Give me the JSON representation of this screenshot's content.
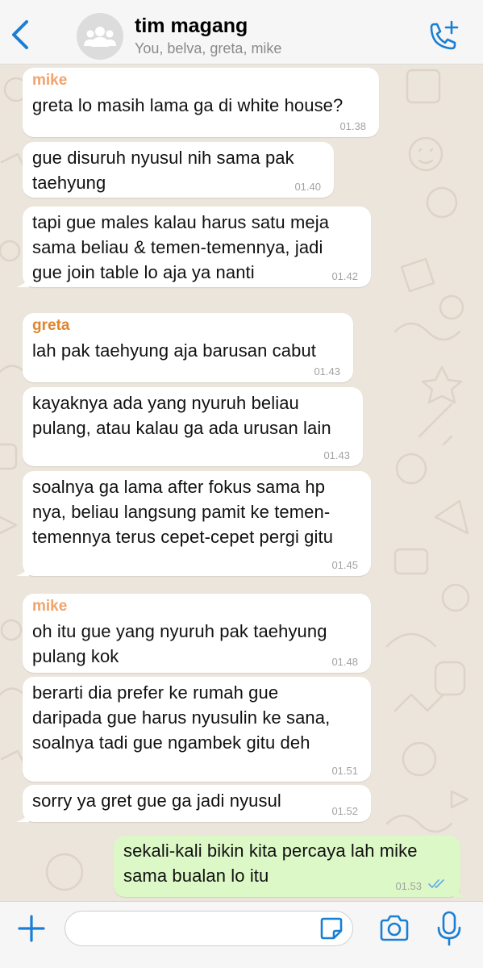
{
  "header": {
    "title": "tim magang",
    "subtitle": "You, belva, greta, mike",
    "back_icon": "chevron-left-icon",
    "avatar_icon": "group-icon",
    "call_icon": "add-call-icon",
    "accent": "#1a7fd4"
  },
  "messages": [
    {
      "sender": "mike",
      "sender_color": "#f0a36b",
      "text": "greta lo masih lama ga di white house?",
      "time": "01.38"
    },
    {
      "text": "gue disuruh nyusul nih sama pak\ntaehyung",
      "time": "01.40"
    },
    {
      "text": "tapi gue males kalau harus satu meja\nsama beliau & temen-temennya, jadi\ngue join table lo aja ya nanti",
      "time": "01.42"
    },
    {
      "sender": "greta",
      "sender_color": "#e0852c",
      "text": "lah pak taehyung aja barusan cabut",
      "time": "01.43"
    },
    {
      "text": "kayaknya ada yang nyuruh beliau\npulang, atau kalau ga ada urusan lain",
      "time": "01.43"
    },
    {
      "text": "soalnya ga lama after fokus sama hp\nnya, beliau langsung pamit ke temen-\ntemennya terus cepet-cepet pergi gitu",
      "time": "01.45"
    },
    {
      "sender": "mike",
      "sender_color": "#f0a36b",
      "text": "oh itu gue yang nyuruh pak taehyung\npulang kok",
      "time": "01.48"
    },
    {
      "text": "berarti dia prefer ke rumah gue\ndaripada gue harus nyusulin ke sana,\nsoalnya tadi gue ngambek gitu deh",
      "time": "01.51"
    },
    {
      "text": "sorry ya gret gue ga jadi nyusul",
      "time": "01.52"
    },
    {
      "text": "sekali-kali bikin kita percaya lah mike\nsama bualan lo itu",
      "time": "01.53",
      "outgoing": true,
      "status_icon": "double-check-icon"
    }
  ],
  "input_bar": {
    "plus_icon": "plus-icon",
    "sticker_icon": "sticker-icon",
    "camera_icon": "camera-icon",
    "mic_icon": "microphone-icon"
  }
}
